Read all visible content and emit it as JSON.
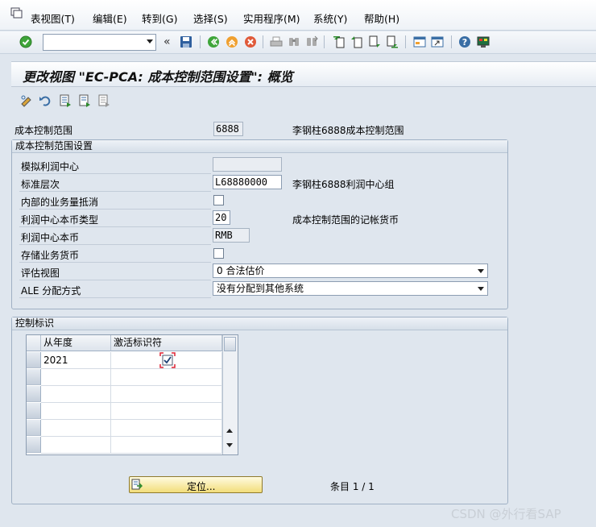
{
  "menu": {
    "items": [
      "表视图(T)",
      "编辑(E)",
      "转到(G)",
      "选择(S)",
      "实用程序(M)",
      "系统(Y)",
      "帮助(H)"
    ]
  },
  "toolbar": {
    "command_value": "",
    "icons": [
      "enter-icon",
      "save-icon",
      "back-icon",
      "exit-icon",
      "cancel-icon",
      "print-icon",
      "find-icon",
      "find-next-icon",
      "first-page-icon",
      "previous-page-icon",
      "next-page-icon",
      "last-page-icon",
      "create-session-icon",
      "shortcut-icon",
      "help-icon",
      "customize-layout-icon"
    ]
  },
  "title": "更改视图 \"EC-PCA: 成本控制范围设置\": 概览",
  "header_fields": {
    "controlling_area_label": "成本控制范围",
    "controlling_area_value": "6888",
    "controlling_area_desc": "李钢柱6888成本控制范围"
  },
  "settings_group": {
    "title": "成本控制范围设置",
    "dummy_pc_label": "模拟利润中心",
    "dummy_pc_value": "",
    "std_hierarchy_label": "标准层次",
    "std_hierarchy_value": "L68880000",
    "std_hierarchy_desc": "李钢柱6888利润中心组",
    "elim_label": "内部的业务量抵消",
    "pc_currency_type_label": "利润中心本币类型",
    "pc_currency_type_value": "20",
    "pc_currency_type_desc": "成本控制范围的记帐货币",
    "pc_currency_label": "利润中心本币",
    "pc_currency_value": "RMB",
    "store_txn_currency_label": "存储业务货币",
    "valuation_view_label": "评估视图",
    "valuation_view_value": "0 合法估价",
    "ale_label": "ALE 分配方式",
    "ale_value": "没有分配到其他系统"
  },
  "control_group": {
    "title": "控制标识",
    "col_year": "从年度",
    "col_active": "激活标识符",
    "rows": [
      {
        "year": "2021",
        "active": true
      }
    ]
  },
  "position_button": "定位...",
  "entry_counter": "条目 1 / 1",
  "watermark": "CSDN @外行看SAP"
}
